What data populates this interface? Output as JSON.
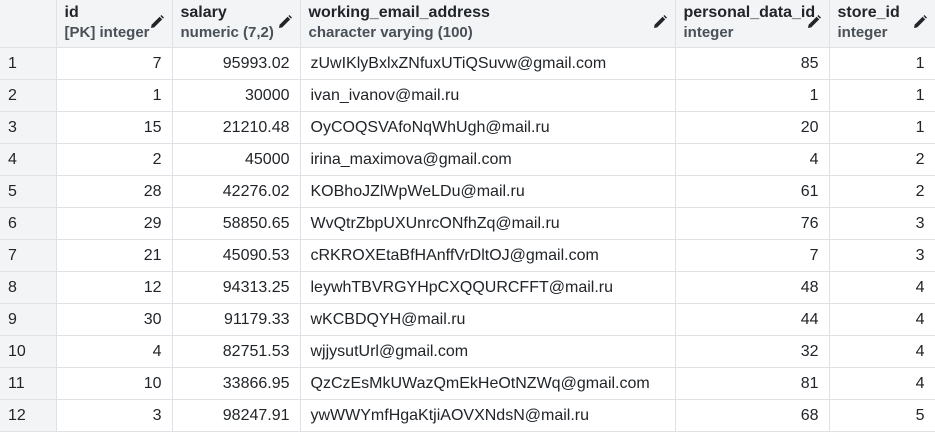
{
  "columns": [
    {
      "name": "id",
      "type": "[PK] integer"
    },
    {
      "name": "salary",
      "type": "numeric (7,2)"
    },
    {
      "name": "working_email_address",
      "type": "character varying (100)"
    },
    {
      "name": "personal_data_id",
      "type": "integer"
    },
    {
      "name": "store_id",
      "type": "integer"
    }
  ],
  "rows": [
    {
      "n": "1",
      "id": "7",
      "salary": "95993.02",
      "email": "zUwIKlyBxlxZNfuxUTiQSuvw@gmail.com",
      "personal_data_id": "85",
      "store_id": "1"
    },
    {
      "n": "2",
      "id": "1",
      "salary": "30000",
      "email": "ivan_ivanov@mail.ru",
      "personal_data_id": "1",
      "store_id": "1"
    },
    {
      "n": "3",
      "id": "15",
      "salary": "21210.48",
      "email": "OyCOQSVAfoNqWhUgh@mail.ru",
      "personal_data_id": "20",
      "store_id": "1"
    },
    {
      "n": "4",
      "id": "2",
      "salary": "45000",
      "email": "irina_maximova@gmail.com",
      "personal_data_id": "4",
      "store_id": "2"
    },
    {
      "n": "5",
      "id": "28",
      "salary": "42276.02",
      "email": "KOBhoJZlWpWeLDu@mail.ru",
      "personal_data_id": "61",
      "store_id": "2"
    },
    {
      "n": "6",
      "id": "29",
      "salary": "58850.65",
      "email": "WvQtrZbpUXUnrcONfhZq@mail.ru",
      "personal_data_id": "76",
      "store_id": "3"
    },
    {
      "n": "7",
      "id": "21",
      "salary": "45090.53",
      "email": "cRKROXEtaBfHAnffVrDltOJ@gmail.com",
      "personal_data_id": "7",
      "store_id": "3"
    },
    {
      "n": "8",
      "id": "12",
      "salary": "94313.25",
      "email": "leywhTBVRGYHpCXQQURCFFT@mail.ru",
      "personal_data_id": "48",
      "store_id": "4"
    },
    {
      "n": "9",
      "id": "30",
      "salary": "91179.33",
      "email": "wKCBDQYH@mail.ru",
      "personal_data_id": "44",
      "store_id": "4"
    },
    {
      "n": "10",
      "id": "4",
      "salary": "82751.53",
      "email": "wjjysutUrl@gmail.com",
      "personal_data_id": "32",
      "store_id": "4"
    },
    {
      "n": "11",
      "id": "10",
      "salary": "33866.95",
      "email": "QzCzEsMkUWazQmEkHeOtNZWq@gmail.com",
      "personal_data_id": "81",
      "store_id": "4"
    },
    {
      "n": "12",
      "id": "3",
      "salary": "98247.91",
      "email": "ywWWYmfHgaKtjiAOVXNdsN@mail.ru",
      "personal_data_id": "68",
      "store_id": "5"
    }
  ]
}
